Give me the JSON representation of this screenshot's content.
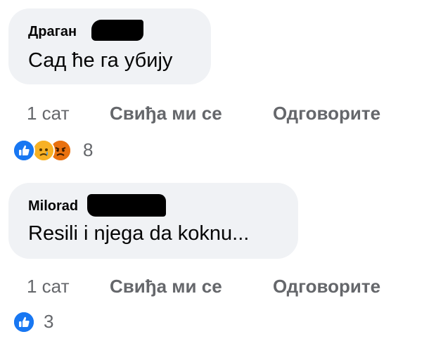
{
  "comments": [
    {
      "author": "Драган",
      "text": "Сад ће га убију",
      "time": "1 сат",
      "like": "Свиђа ми се",
      "reply": "Одговорите",
      "reaction_count": "8",
      "reactions": [
        "like-icon",
        "sad-icon",
        "angry-icon"
      ]
    },
    {
      "author": "Milorad",
      "text": "Resili i njega da koknu...",
      "time": "1 сат",
      "like": "Свиђа ми се",
      "reply": "Одговорите",
      "reaction_count": "3",
      "reactions": [
        "like-icon"
      ]
    }
  ],
  "colors": {
    "bubble": "#f0f2f5",
    "meta_text": "#65676b",
    "like_blue": "#1877f2",
    "sad_yellow": "#f7b125",
    "angry_orange": "#e9710f"
  }
}
